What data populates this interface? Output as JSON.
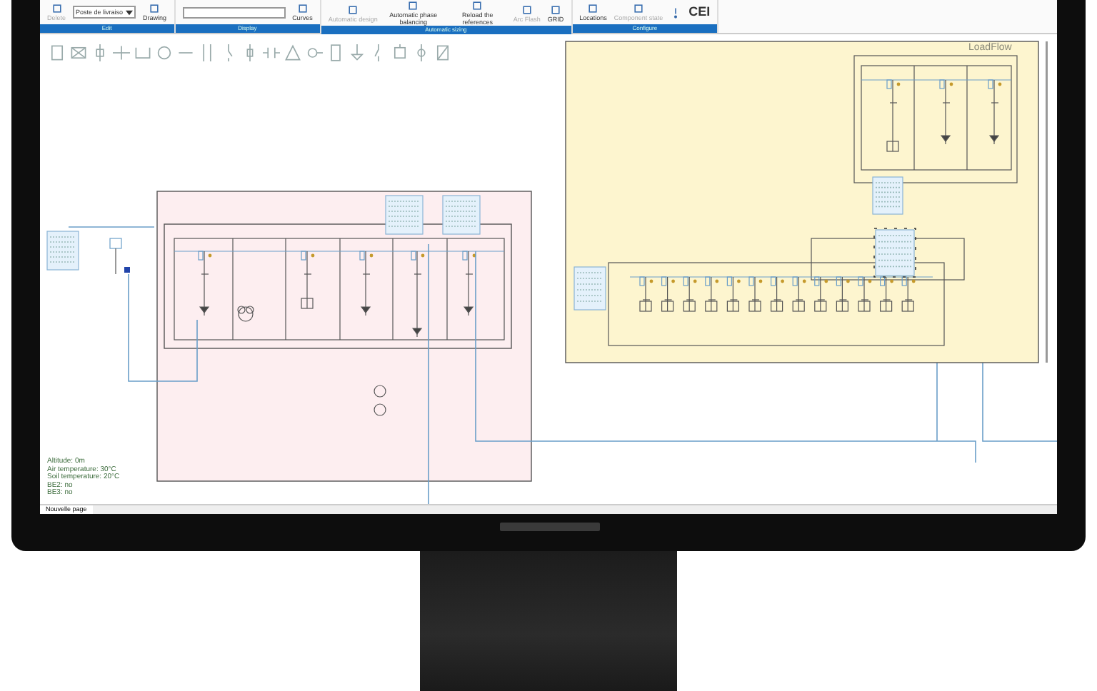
{
  "ribbon": {
    "groups": [
      {
        "label": "Edit",
        "items": [
          {
            "kind": "button",
            "label": "Delete",
            "disabled": true
          },
          {
            "kind": "dropdown",
            "value": "Poste de livraiso",
            "disabled": false
          },
          {
            "kind": "button",
            "label": "Drawing",
            "disabled": false
          }
        ]
      },
      {
        "label": "Display",
        "items": [
          {
            "kind": "field"
          },
          {
            "kind": "button",
            "label": "Curves",
            "disabled": false
          }
        ]
      },
      {
        "label": "Automatic sizing",
        "items": [
          {
            "kind": "button",
            "label": "Automatic design",
            "disabled": true
          },
          {
            "kind": "button",
            "label": "Automatic phase balancing",
            "disabled": false
          },
          {
            "kind": "button",
            "label": "Reload the references",
            "disabled": false
          },
          {
            "kind": "button",
            "label": "Arc Flash",
            "disabled": true
          },
          {
            "kind": "button",
            "label": "GRID",
            "disabled": false
          }
        ]
      },
      {
        "label": "Configure",
        "items": [
          {
            "kind": "button",
            "label": "Locations",
            "disabled": false
          },
          {
            "kind": "button",
            "label": "Component state",
            "disabled": true
          },
          {
            "kind": "alert"
          },
          {
            "kind": "standard",
            "label": "CEI",
            "disabled": false
          }
        ]
      }
    ]
  },
  "canvas": {
    "panel_label": "LoadFlow",
    "site_conditions": [
      "Altitude: 0m",
      "Air temperature: 30°C",
      "Soil temperature: 20°C",
      "BE2: no",
      "BE3: no"
    ]
  },
  "page_tabs": [
    {
      "label": "Nouvelle page",
      "selected": true
    }
  ]
}
